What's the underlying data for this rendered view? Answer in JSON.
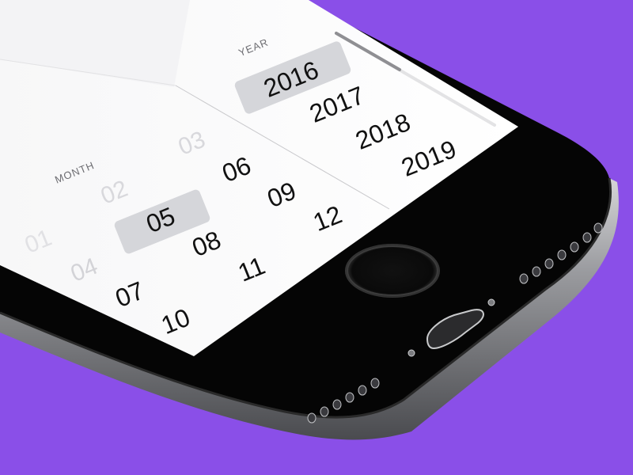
{
  "background_color": "#8a4fe8",
  "picker": {
    "month_label": "MONTH",
    "year_label": "YEAR",
    "months": [
      "01",
      "02",
      "03",
      "04",
      "05",
      "06",
      "07",
      "08",
      "09",
      "10",
      "11",
      "12"
    ],
    "selected_month": "05",
    "years": [
      "2016",
      "2017",
      "2018",
      "2019"
    ],
    "selected_year": "2016"
  },
  "device": {
    "home_button_icon": "home-button-icon",
    "port_icon": "lightning-port-icon",
    "speaker_icon": "speaker-grille-icon",
    "screw_icon": "screw-icon"
  }
}
